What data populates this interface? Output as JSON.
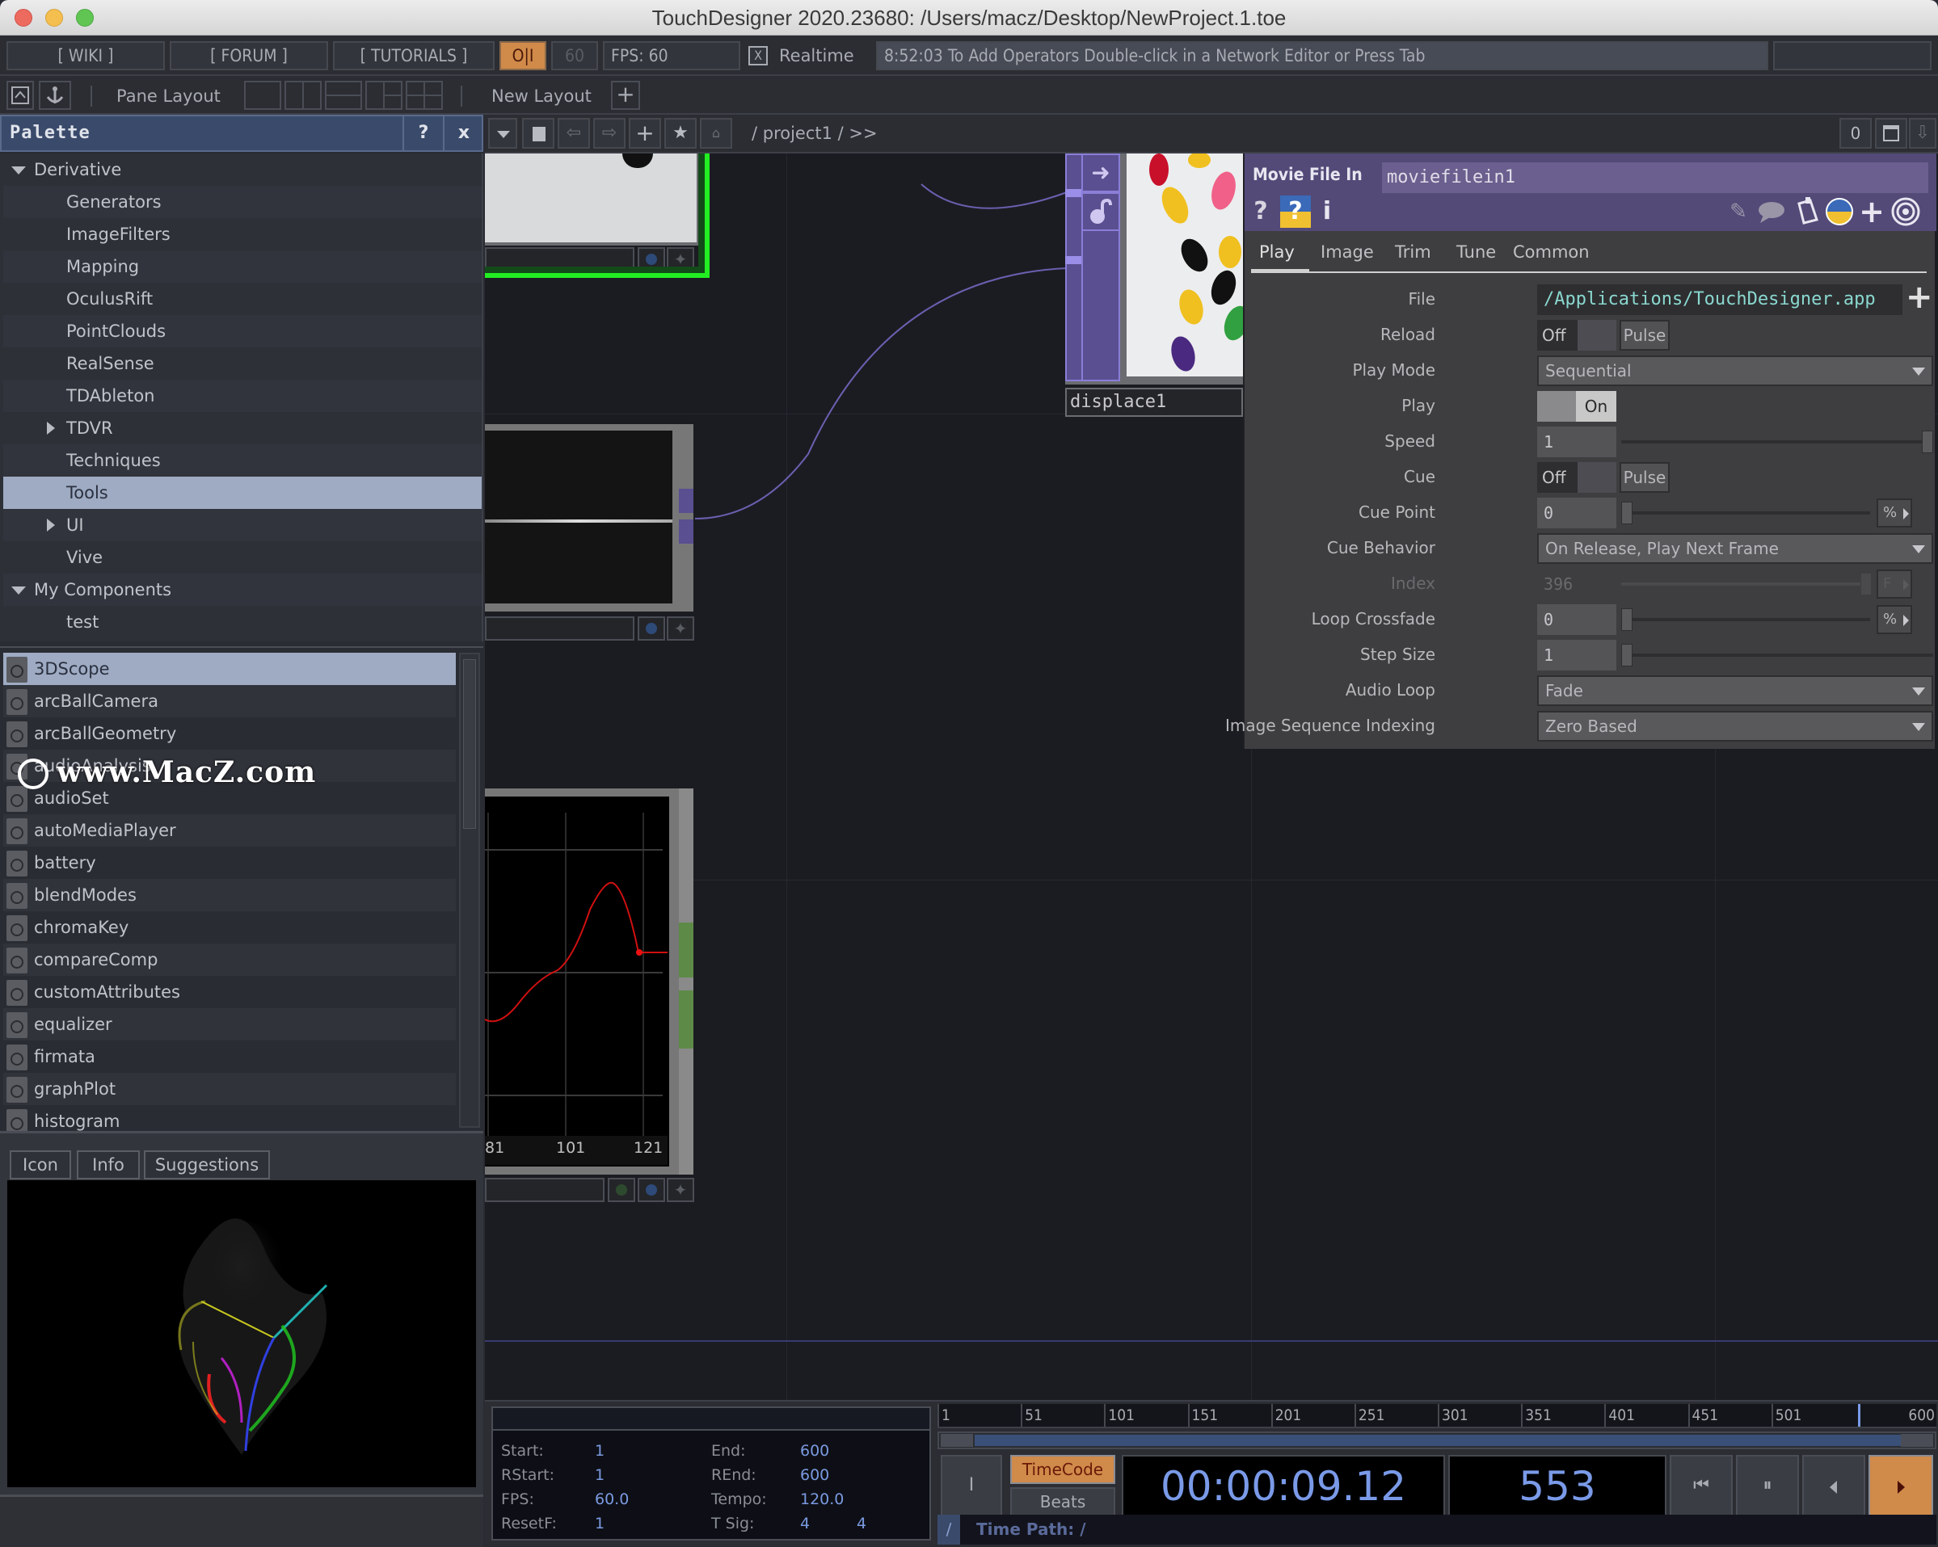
{
  "window": {
    "title": "TouchDesigner 2020.23680: /Users/macz/Desktop/NewProject.1.toe"
  },
  "toolbar": {
    "wiki": "[ WIKI ]",
    "forum": "[ FORUM ]",
    "tutorials": "[ TUTORIALS ]",
    "oi_toggle": "O|I",
    "fps_cap": "60",
    "fps_readout": "FPS:  60",
    "realtime_checkbox": "X",
    "realtime_label": "Realtime",
    "status_message": "8:52:03 To Add Operators Double-click in a Network Editor or Press Tab",
    "pane_layout_label": "Pane Layout",
    "new_layout_label": "New Layout",
    "new_layout_add": "+"
  },
  "palette": {
    "title": "Palette",
    "help": "?",
    "close": "x",
    "tree": [
      {
        "label": "Derivative",
        "level": 0,
        "expander": "down"
      },
      {
        "label": "Generators",
        "level": 1
      },
      {
        "label": "ImageFilters",
        "level": 1
      },
      {
        "label": "Mapping",
        "level": 1
      },
      {
        "label": "OculusRift",
        "level": 1
      },
      {
        "label": "PointClouds",
        "level": 1
      },
      {
        "label": "RealSense",
        "level": 1
      },
      {
        "label": "TDAbleton",
        "level": 1
      },
      {
        "label": "TDVR",
        "level": 1,
        "expander": "right"
      },
      {
        "label": "Techniques",
        "level": 1
      },
      {
        "label": "Tools",
        "level": 1,
        "selected": true
      },
      {
        "label": "UI",
        "level": 1,
        "expander": "right"
      },
      {
        "label": "Vive",
        "level": 1
      },
      {
        "label": "My Components",
        "level": 0,
        "expander": "down"
      },
      {
        "label": "test",
        "level": 1
      }
    ],
    "components": [
      {
        "label": "3DScope",
        "selected": true
      },
      {
        "label": "arcBallCamera"
      },
      {
        "label": "arcBallGeometry"
      },
      {
        "label": "audioAnalysis"
      },
      {
        "label": "audioSet"
      },
      {
        "label": "autoMediaPlayer"
      },
      {
        "label": "battery"
      },
      {
        "label": "blendModes"
      },
      {
        "label": "chromaKey"
      },
      {
        "label": "compareComp"
      },
      {
        "label": "customAttributes"
      },
      {
        "label": "equalizer"
      },
      {
        "label": "firmata"
      },
      {
        "label": "graphPlot"
      },
      {
        "label": "histogram"
      }
    ],
    "watermark": "www.MacZ.com",
    "info_tabs": [
      {
        "label": "Icon",
        "active": true
      },
      {
        "label": "Info"
      },
      {
        "label": "Suggestions"
      }
    ]
  },
  "network": {
    "path": "/ project1 / >>",
    "counter": "0",
    "nodes": {
      "displace": {
        "name": "displace1"
      },
      "chop_graph": {
        "ticks": [
          "81",
          "101",
          "121"
        ]
      }
    }
  },
  "params": {
    "op_type": "Movie File In",
    "op_name": "moviefilein1",
    "tabs": [
      "Play",
      "Image",
      "Trim",
      "Tune",
      "Common"
    ],
    "active_tab": "Play",
    "rows": {
      "file": {
        "label": "File",
        "value": "/Applications/TouchDesigner.app"
      },
      "reload": {
        "label": "Reload",
        "value": "Off",
        "pulse": "Pulse"
      },
      "play_mode": {
        "label": "Play Mode",
        "value": "Sequential"
      },
      "play": {
        "label": "Play",
        "value": "On"
      },
      "speed": {
        "label": "Speed",
        "value": "1"
      },
      "cue": {
        "label": "Cue",
        "value": "Off",
        "pulse": "Pulse"
      },
      "cue_point": {
        "label": "Cue Point",
        "value": "0",
        "unit": "%"
      },
      "cue_behavior": {
        "label": "Cue Behavior",
        "value": "On Release, Play Next Frame"
      },
      "index": {
        "label": "Index",
        "value": "396",
        "unit": "F"
      },
      "loop_crossfade": {
        "label": "Loop Crossfade",
        "value": "0",
        "unit": "%"
      },
      "step_size": {
        "label": "Step Size",
        "value": "1"
      },
      "audio_loop": {
        "label": "Audio Loop",
        "value": "Fade"
      },
      "image_seq_indexing": {
        "label": "Image Sequence Indexing",
        "value": "Zero Based"
      }
    }
  },
  "timeline": {
    "range": {
      "start_label": "Start:",
      "start": "1",
      "end_label": "End:",
      "end": "600",
      "rstart_label": "RStart:",
      "rstart": "1",
      "rend_label": "REnd:",
      "rend": "600",
      "fps_label": "FPS:",
      "fps": "60.0",
      "tempo_label": "Tempo:",
      "tempo": "120.0",
      "resetf_label": "ResetF:",
      "resetf": "1",
      "tsig_label": "T Sig:",
      "tsig_num": "4",
      "tsig_den": "4"
    },
    "ruler_ticks": [
      "1",
      "51",
      "101",
      "151",
      "201",
      "251",
      "301",
      "351",
      "401",
      "451",
      "501",
      "600"
    ],
    "playhead_frame": 553,
    "range_end": 600,
    "timecode_label": "TimeCode",
    "beats_label": "Beats",
    "timecode": "00:00:09.12",
    "frame": "553",
    "time_path_slash": "/",
    "time_path": "Time Path: /"
  },
  "colors": {
    "accent_orange": "#d08a4a",
    "palette_header": "#3a4a6b",
    "param_header": "#534a78",
    "selection": "#9eabc2",
    "node_selected_outline": "#22ee22",
    "timecode_text": "#7a9ae8"
  }
}
